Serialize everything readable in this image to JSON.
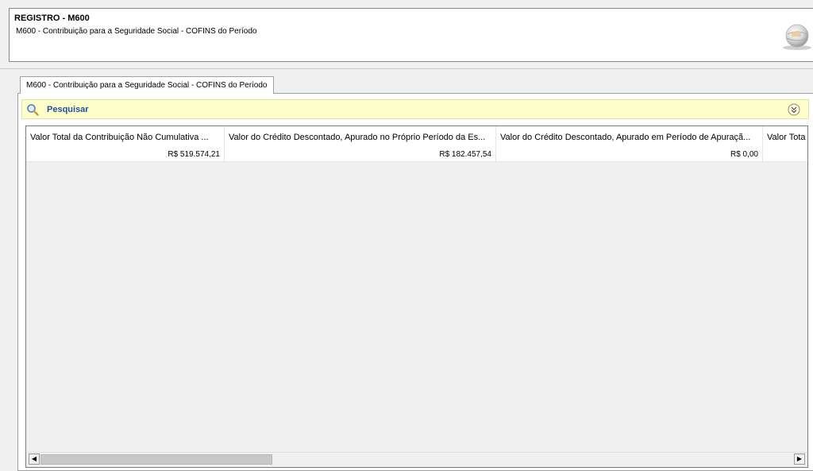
{
  "header": {
    "title": "REGISTRO - M600",
    "subtitle": "M600 - Contribuição para a Seguridade Social - COFINS do Período",
    "logo_icon": "globe-logo-icon"
  },
  "tab": {
    "label": "M600 - Contribuição para a Seguridade Social - COFINS do Período"
  },
  "search": {
    "label": "Pesquisar",
    "icon": "magnifier-icon",
    "expand_icon": "double-chevron-down-icon",
    "bar_color": "#ffffcc",
    "label_color": "#1f4fa3"
  },
  "grid": {
    "columns": [
      "Valor Total da Contribuição Não Cumulativa ...",
      "Valor do Crédito Descontado, Apurado no Próprio Período da Es...",
      "Valor do Crédito Descontado, Apurado em Período de Apuraçã...",
      "Valor Tota"
    ],
    "rows": [
      [
        "R$ 519.574,21",
        "R$ 182.457,54",
        "R$ 0,00",
        ""
      ]
    ]
  }
}
